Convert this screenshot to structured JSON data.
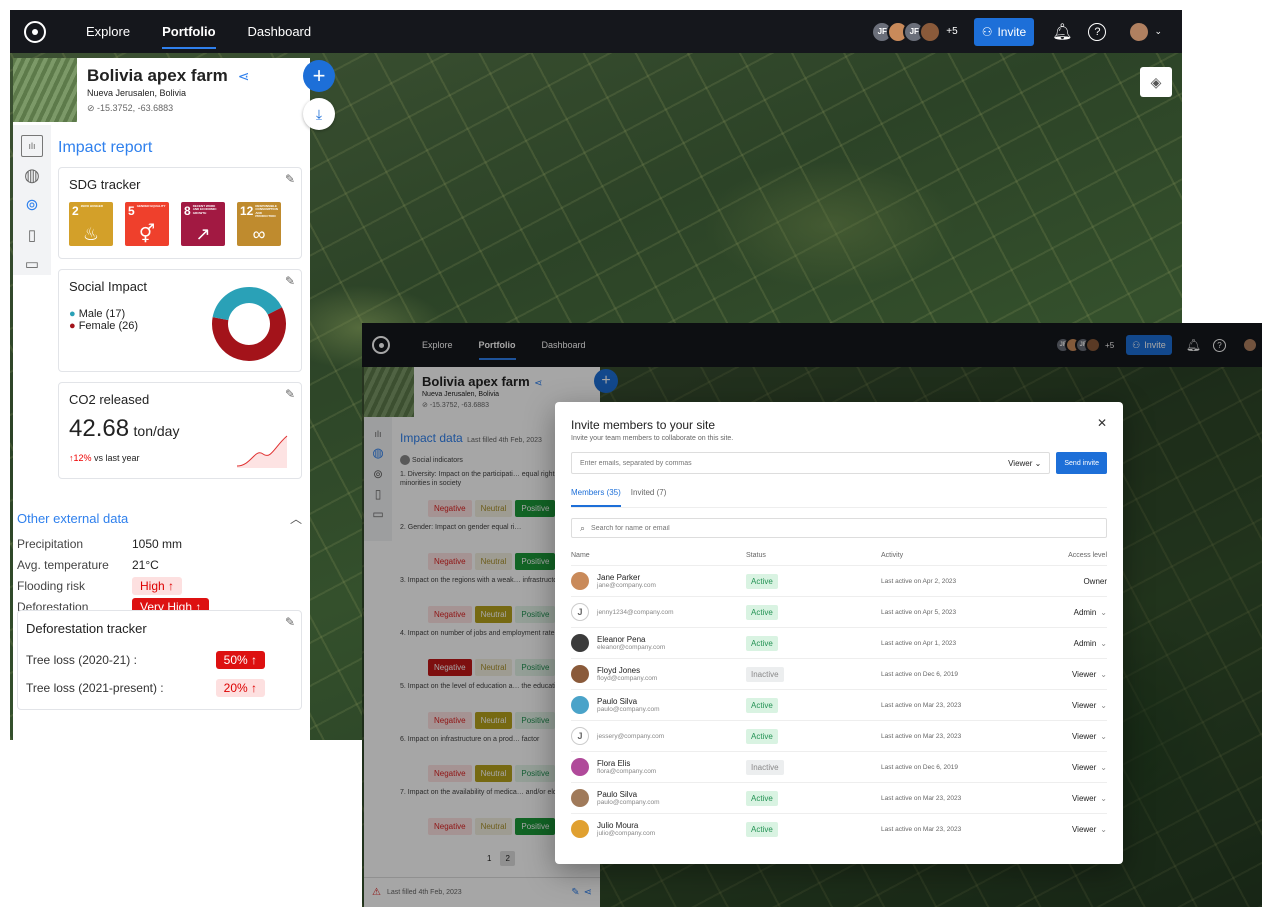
{
  "nav": {
    "explore": "Explore",
    "portfolio": "Portfolio",
    "dashboard": "Dashboard"
  },
  "topbar": {
    "avatar1": "JF",
    "avatar3": "JF",
    "more": "+5",
    "invite": "Invite"
  },
  "site": {
    "name": "Bolivia apex farm",
    "location": "Nueva Jerusalen, Bolivia",
    "coords": "-15.3752, -63.6883"
  },
  "report": {
    "title": "Impact report",
    "sdg": {
      "title": "SDG tracker",
      "goals": [
        {
          "num": "2",
          "label": "ZERO HUNGER",
          "color": "#d3a029",
          "glyph": "♨"
        },
        {
          "num": "5",
          "label": "GENDER EQUALITY",
          "color": "#ef402c",
          "glyph": "⚥"
        },
        {
          "num": "8",
          "label": "DECENT WORK AND ECONOMIC GROWTH",
          "color": "#a21942",
          "glyph": "↗"
        },
        {
          "num": "12",
          "label": "RESPONSIBLE CONSUMPTION AND PRODUCTION",
          "color": "#bf8b2e",
          "glyph": "∞"
        }
      ]
    },
    "social": {
      "title": "Social Impact",
      "male": "Male (17)",
      "female": "Female (26)",
      "male_count": 17,
      "female_count": 26,
      "male_color": "#2aa1b7",
      "female_color": "#a3131a"
    },
    "co2": {
      "title": "CO2 released",
      "value": "42.68",
      "unit": "ton/day",
      "change": "12%",
      "change_note": "vs last year"
    },
    "external": {
      "title": "Other external data",
      "rows": [
        {
          "label": "Precipitation",
          "value": "1050 mm"
        },
        {
          "label": "Avg. temperature",
          "value": "21°C"
        },
        {
          "label": "Flooding risk",
          "value": "High ↑"
        },
        {
          "label": "Deforestation",
          "value": "Very High ↑"
        }
      ]
    },
    "deforest": {
      "title": "Deforestation tracker",
      "rows": [
        {
          "label": "Tree loss (2020-21) :",
          "value": "50% ↑"
        },
        {
          "label": "Tree loss (2021-present) :",
          "value": "20% ↑"
        }
      ]
    }
  },
  "impact": {
    "title": "Impact data",
    "last": "Last filled 4th Feb, 2023",
    "section": "Social indicators",
    "items": [
      {
        "text": "1. Diversity: Impact on the participati… equal rights of minorities in society",
        "sel": "pos"
      },
      {
        "text": "2. Gender: Impact on gender equal ri…",
        "sel": "pos"
      },
      {
        "text": "3. Impact on the regions with a weak… infrastructor",
        "sel": "neu"
      },
      {
        "text": "4. Impact on number of jobs and employment rate",
        "sel": "neg"
      },
      {
        "text": "5. Impact on the level of education a… the education system",
        "sel": "neu"
      },
      {
        "text": "6. Impact on infrastructure on a prod… factor",
        "sel": "neu"
      },
      {
        "text": "7. Impact on the availability of medica… and/or elderly care",
        "sel": "pos"
      }
    ],
    "neg": "Negative",
    "neu": "Neutral",
    "pos": "Positive",
    "pages": [
      "1",
      "2"
    ],
    "footer": "Last filled 4th Feb, 2023"
  },
  "modal": {
    "title": "Invite members to your site",
    "subtitle": "Invite your team members to collaborate on this site.",
    "email_placeholder": "Enter emails, separated by commas",
    "role": "Viewer",
    "send": "Send invite",
    "tab_members": "Members (35)",
    "tab_invited": "Invited (7)",
    "search_placeholder": "Search for name or email",
    "cols": {
      "name": "Name",
      "status": "Status",
      "activity": "Activity",
      "access": "Access level"
    },
    "members": [
      {
        "name": "Jane Parker",
        "email": "jane@company.com",
        "status": "Active",
        "activity": "Last active on Apr 2, 2023",
        "access": "Owner",
        "color": "#c98a5a"
      },
      {
        "name": "",
        "email": "jenny1234@company.com",
        "status": "Active",
        "activity": "Last active on Apr 5, 2023",
        "access": "Admin",
        "color": "",
        "initial": "J"
      },
      {
        "name": "Eleanor Pena",
        "email": "eleanor@company.com",
        "status": "Active",
        "activity": "Last active on Apr 1, 2023",
        "access": "Admin",
        "color": "#3b3b3b"
      },
      {
        "name": "Floyd Jones",
        "email": "floyd@company.com",
        "status": "Inactive",
        "activity": "Last active on Dec 6, 2019",
        "access": "Viewer",
        "color": "#8a5a3a"
      },
      {
        "name": "Paulo Silva",
        "email": "paulo@company.com",
        "status": "Active",
        "activity": "Last active on Mar 23, 2023",
        "access": "Viewer",
        "color": "#4aa3c9"
      },
      {
        "name": "",
        "email": "jessery@company.com",
        "status": "Active",
        "activity": "Last active on Mar 23, 2023",
        "access": "Viewer",
        "color": "",
        "initial": "J"
      },
      {
        "name": "Flora Elis",
        "email": "flora@company.com",
        "status": "Inactive",
        "activity": "Last active on Dec 6, 2019",
        "access": "Viewer",
        "color": "#b04a9a"
      },
      {
        "name": "Paulo Silva",
        "email": "paulo@company.com",
        "status": "Active",
        "activity": "Last active on Mar 23, 2023",
        "access": "Viewer",
        "color": "#a07a5a"
      },
      {
        "name": "Julio Moura",
        "email": "julio@company.com",
        "status": "Active",
        "activity": "Last active on Mar 23, 2023",
        "access": "Viewer",
        "color": "#e0a030"
      }
    ]
  }
}
